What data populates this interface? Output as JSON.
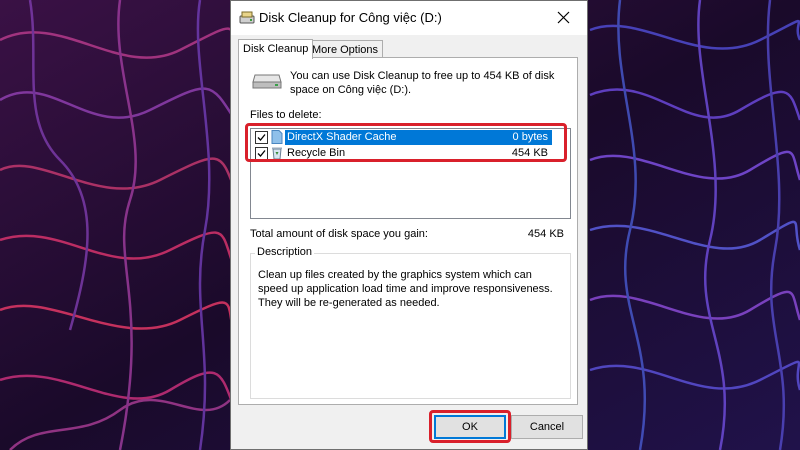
{
  "window": {
    "title": "Disk Cleanup for Công việc (D:)"
  },
  "tabs": [
    {
      "label": "Disk Cleanup",
      "active": true
    },
    {
      "label": "More Options",
      "active": false
    }
  ],
  "intro": "You can use Disk Cleanup to free up to 454 KB of disk space on Công việc (D:).",
  "files_label": "Files to delete:",
  "files": [
    {
      "name": "DirectX Shader Cache",
      "size": "0 bytes",
      "checked": true,
      "selected": true,
      "icon": "file-icon"
    },
    {
      "name": "Recycle Bin",
      "size": "454 KB",
      "checked": true,
      "selected": false,
      "icon": "recycle-bin-icon"
    }
  ],
  "total": {
    "label": "Total amount of disk space you gain:",
    "value": "454 KB"
  },
  "description": {
    "legend": "Description",
    "text": "Clean up files created by the graphics system which can speed up application load time and improve responsiveness. They will be re-generated as needed."
  },
  "buttons": {
    "ok": "OK",
    "cancel": "Cancel"
  },
  "colors": {
    "selection": "#0078d7",
    "highlight_annotation": "#d9202b",
    "wallpaper_dark": "#1d0b2c"
  }
}
